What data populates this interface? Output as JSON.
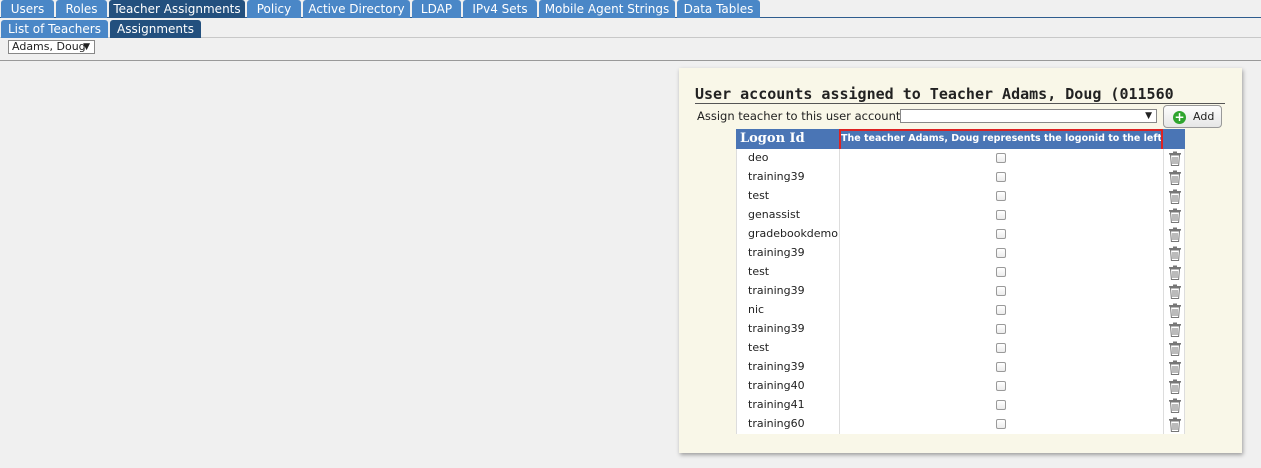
{
  "tabs": [
    {
      "label": "Users",
      "active": false
    },
    {
      "label": "Roles",
      "active": false
    },
    {
      "label": "Teacher Assignments",
      "active": true
    },
    {
      "label": "Policy",
      "active": false
    },
    {
      "label": "Active Directory",
      "active": false
    },
    {
      "label": "LDAP",
      "active": false
    },
    {
      "label": "IPv4 Sets",
      "active": false
    },
    {
      "label": "Mobile Agent Strings",
      "active": false
    },
    {
      "label": "Data Tables",
      "active": false
    }
  ],
  "subtabs": [
    {
      "label": "List of Teachers",
      "active": false
    },
    {
      "label": "Assignments",
      "active": true
    }
  ],
  "teacher_select": {
    "value": "Adams, Doug"
  },
  "panel": {
    "title": "User accounts assigned to Teacher Adams, Doug (011560",
    "assign_label": "Assign teacher to this user account:",
    "assign_value": "",
    "add_label": "Add",
    "col_logon": "Logon Id",
    "col_represents": "The teacher Adams, Doug represents the logonid to the left",
    "rows": [
      {
        "logon": "deo",
        "checked": false
      },
      {
        "logon": "training39",
        "checked": false
      },
      {
        "logon": "test",
        "checked": false
      },
      {
        "logon": "genassist",
        "checked": false
      },
      {
        "logon": "gradebookdemo",
        "checked": false
      },
      {
        "logon": "training39",
        "checked": false
      },
      {
        "logon": "test",
        "checked": false
      },
      {
        "logon": "training39",
        "checked": false
      },
      {
        "logon": "nic",
        "checked": false
      },
      {
        "logon": "training39",
        "checked": false
      },
      {
        "logon": "test",
        "checked": false
      },
      {
        "logon": "training39",
        "checked": false
      },
      {
        "logon": "training40",
        "checked": false
      },
      {
        "logon": "training41",
        "checked": false
      },
      {
        "logon": "training60",
        "checked": false
      }
    ]
  },
  "colors": {
    "tab": "#4a87c7",
    "tab_active": "#23507e",
    "panel_bg": "#f9f7e8",
    "grid_header": "#4a75b5",
    "highlight_border": "#dd2222",
    "add_icon": "#2fa52f"
  },
  "icons": {
    "dropdown": "chevron-down-icon",
    "add": "plus-circle-icon",
    "delete": "trash-icon"
  }
}
